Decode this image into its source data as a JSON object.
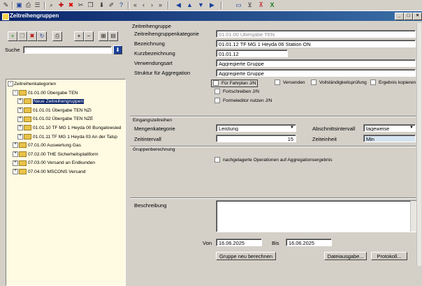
{
  "toolbar": {
    "icons": [
      "pencil-icon",
      "save-icon",
      "print-icon",
      "list-icon",
      "binoculars-icon",
      "new-icon",
      "delete-icon",
      "cut-icon",
      "copy-icon",
      "download-icon",
      "tag-icon",
      "help-icon",
      "first-icon",
      "prev-icon",
      "next-icon",
      "last-icon",
      "back-icon",
      "up-icon",
      "down-icon",
      "forward-icon",
      "monitor-icon",
      "filter-icon",
      "filter-clear-icon",
      "excel-icon"
    ]
  },
  "window": {
    "title": "Zeitreihengruppen"
  },
  "left": {
    "search_label": "Suche",
    "search_value": "",
    "tree": [
      {
        "label": "Zeitreihenkategorien",
        "indent": 0,
        "sign": "-",
        "folder": false
      },
      {
        "label": "01.01.00 Übergabe TEN",
        "indent": 1,
        "sign": "-",
        "folder": true
      },
      {
        "label": "Neue Zeitreihengruppen",
        "indent": 2,
        "sign": "+",
        "folder": true,
        "selected": true
      },
      {
        "label": "01.01.01 Übergabe TEN NZI",
        "indent": 2,
        "sign": "+",
        "folder": true
      },
      {
        "label": "01.01.02 Übergabe TEN NZE",
        "indent": 2,
        "sign": "+",
        "folder": true
      },
      {
        "label": "01.01.10 TF MG 1 Heyda 00 Bungalowsied",
        "indent": 2,
        "sign": "+",
        "folder": true
      },
      {
        "label": "01.01.11 TF MG 1 Heyda 03 An der Talsp",
        "indent": 2,
        "sign": "+",
        "folder": true
      },
      {
        "label": "07.01.00 Auswertung Gas",
        "indent": 1,
        "sign": "+",
        "folder": true
      },
      {
        "label": "07.02.00 THE Sicherheitsplattform",
        "indent": 1,
        "sign": "+",
        "folder": true
      },
      {
        "label": "07.03.00 Versand an Endkunden",
        "indent": 1,
        "sign": "+",
        "folder": true
      },
      {
        "label": "07.04.00 MSCONS Versand",
        "indent": 1,
        "sign": "+",
        "folder": true
      }
    ]
  },
  "form": {
    "section_title": "Zeitreihengruppe",
    "kategorie_label": "Zeitreihengruppenkategorie",
    "kategorie_value": "01.01.00 Übergabe TEN",
    "bezeichnung_label": "Bezeichnung",
    "bezeichnung_value": "01.01.12 TF MG 1 Heyda 06 Station ON",
    "kurz_label": "Kurzbezeichnung",
    "kurz_value": "01.01.12",
    "verwendung_label": "Verwendungsart",
    "verwendung_value": "Aggregierte Gruppe",
    "struktur_label": "Struktur für Aggregation",
    "struktur_value": "Aggregierte Gruppe",
    "chk_fahrplan": "Für Fahrplan J/N",
    "chk_versenden": "Versenden",
    "chk_vollst": "Vollständigkeitsprüfung",
    "chk_ergebnis": "Ergebnis kopieren",
    "chk_fortschreiben": "Fortschreiben J/N",
    "chk_formeleditor": "Formeleditor nutzen J/N",
    "eingang_title": "Eingangszeitreihen",
    "mengen_label": "Mengenkategorie",
    "mengen_value": "Leistung",
    "abschnitt_label": "Abschnittsintervall",
    "abschnitt_value": "tageweise",
    "zeitintervall_label": "Zeitintervall",
    "zeitintervall_value": "15",
    "zeiteinheit_label": "Zeiteinheit",
    "zeiteinheit_value": "Min",
    "gruppen_title": "Gruppenberechnung",
    "chk_nachgelagert": "nachgelagerte Operationen auf Aggregationsergebnis",
    "beschreibung_label": "Beschreibung",
    "beschreibung_value": "",
    "von_label": "Von",
    "von_value": "16.06.2025",
    "bis_label": "Bis",
    "bis_value": "16.06.2025",
    "btn_berechnen": "Gruppe neu berechnen",
    "btn_datei": "Dateiausgabe...",
    "btn_protokoll": "Protokoll..."
  }
}
